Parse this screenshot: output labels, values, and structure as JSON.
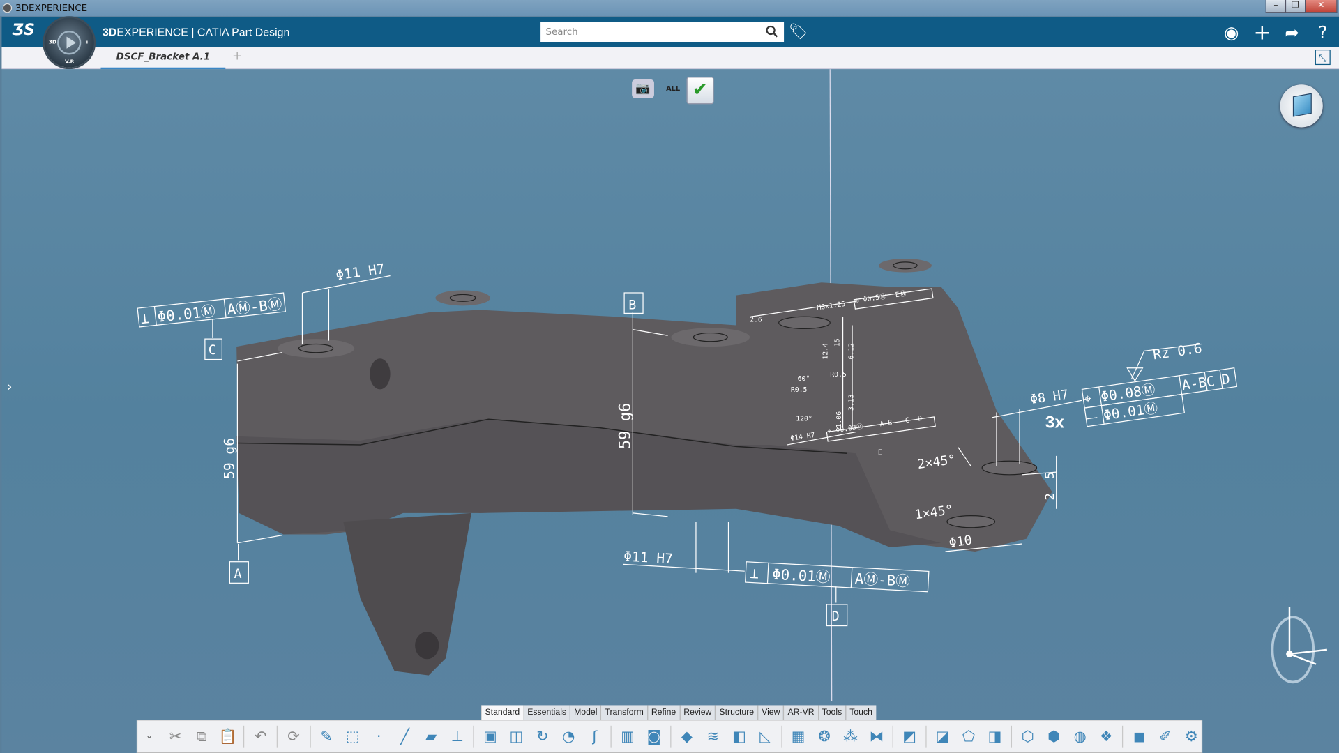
{
  "window": {
    "title": "3DEXPERIENCE",
    "controls": [
      "minimize",
      "restore",
      "close"
    ]
  },
  "header": {
    "brand_bold": "3D",
    "brand_rest": "EXPERIENCE",
    "brand_sep": " | ",
    "app": "CATIA Part Design",
    "search_placeholder": "Search",
    "compass_labels": [
      "3D",
      "V.R",
      "i"
    ]
  },
  "tabs": {
    "document": "DSCF_Bracket A.1",
    "add": "+"
  },
  "viewport": {
    "filter_label": "ALL"
  },
  "annotations": {
    "top_left_fcf": [
      "⊥",
      "Φ0.01Ⓜ",
      "AⓂ-BⓂ"
    ],
    "hole_top": "Φ11 H7",
    "datum_c": "C",
    "datum_b": "B",
    "datum_a": "A",
    "datum_d": "D",
    "datum_e": "E",
    "height_left": "59 g6",
    "height_mid": "59 g6",
    "hole_bottom": "Φ11 H7",
    "bottom_fcf": [
      "⊥",
      "Φ0.01Ⓜ",
      "AⓂ-BⓂ"
    ],
    "thread": "M8x1.25",
    "thread_fcf": [
      "◎",
      "Φ0.5Ⓜ",
      "EⓂ"
    ],
    "dim_2_6": "2.6",
    "dim_12_4": "12.4",
    "dim_15": "15",
    "dim_6_12": "6.12",
    "r05a": "R0.5",
    "r05b": "R0.5",
    "ang60": "60°",
    "ang120": "120°",
    "dim_1_06": "1.06",
    "dim_3_13": "3.13",
    "hole14": "Φ14 H7",
    "hole14_fcf": [
      "⌖",
      "Φ0.03Ⓜ",
      "A-B",
      "C",
      "D"
    ],
    "rz": "Rz 0.6",
    "hole8": "Φ8 H7",
    "count": "3x",
    "pos_fcf": [
      "⌖",
      "Φ0.08Ⓜ",
      "A-B",
      "C",
      "D"
    ],
    "flat_fcf": [
      "⏤",
      "Φ0.01Ⓜ"
    ],
    "chamfer1": "2×45°",
    "chamfer2": "1×45°",
    "dim_5": "5",
    "dim_2": "2",
    "hole10": "Φ10"
  },
  "toolbar": {
    "tabs": [
      "Standard",
      "Essentials",
      "Model",
      "Transform",
      "Refine",
      "Review",
      "Structure",
      "View",
      "AR-VR",
      "Tools",
      "Touch"
    ],
    "active_tab": "Standard",
    "tools": [
      {
        "name": "cut-icon",
        "g": "✂"
      },
      {
        "name": "copy-icon",
        "g": "⧉"
      },
      {
        "name": "paste-icon",
        "g": "📋"
      },
      {
        "name": "sep"
      },
      {
        "name": "undo-icon",
        "g": "↶"
      },
      {
        "name": "sep"
      },
      {
        "name": "update-icon",
        "g": "⟳"
      },
      {
        "name": "sep"
      },
      {
        "name": "sketch-icon",
        "g": "✎"
      },
      {
        "name": "positioned-sketch-icon",
        "g": "⬚"
      },
      {
        "name": "point-icon",
        "g": "·"
      },
      {
        "name": "line-icon",
        "g": "╱"
      },
      {
        "name": "plane-icon",
        "g": "▰"
      },
      {
        "name": "axis-system-icon",
        "g": "⊥"
      },
      {
        "name": "sep"
      },
      {
        "name": "pad-icon",
        "g": "▣"
      },
      {
        "name": "pocket-icon",
        "g": "◫"
      },
      {
        "name": "shaft-icon",
        "g": "↻"
      },
      {
        "name": "groove-icon",
        "g": "◔"
      },
      {
        "name": "rib-icon",
        "g": "ʃ"
      },
      {
        "name": "sep"
      },
      {
        "name": "thread-icon",
        "g": "▥"
      },
      {
        "name": "hole-icon",
        "g": "◙"
      },
      {
        "name": "sep"
      },
      {
        "name": "thick-surface-icon",
        "g": "◆"
      },
      {
        "name": "close-surface-icon",
        "g": "≋"
      },
      {
        "name": "shell-icon",
        "g": "◧"
      },
      {
        "name": "stiffener-icon",
        "g": "◺"
      },
      {
        "name": "sep"
      },
      {
        "name": "rectangular-pattern-icon",
        "g": "▦"
      },
      {
        "name": "circular-pattern-icon",
        "g": "❂"
      },
      {
        "name": "user-pattern-icon",
        "g": "⁂"
      },
      {
        "name": "mirror-icon",
        "g": "⧓"
      },
      {
        "name": "sep"
      },
      {
        "name": "draft-icon",
        "g": "◩"
      },
      {
        "name": "sep"
      },
      {
        "name": "fillet-icon",
        "g": "◪"
      },
      {
        "name": "chamfer-icon",
        "g": "⬠"
      },
      {
        "name": "remove-face-icon",
        "g": "◨"
      },
      {
        "name": "sep"
      },
      {
        "name": "add-body-icon",
        "g": "⬡"
      },
      {
        "name": "remove-body-icon",
        "g": "⬢"
      },
      {
        "name": "intersect-body-icon",
        "g": "◍"
      },
      {
        "name": "union-trim-icon",
        "g": "❖"
      },
      {
        "name": "sep"
      },
      {
        "name": "measure-icon",
        "g": "◼"
      },
      {
        "name": "3d-annotation-icon",
        "g": "✐"
      },
      {
        "name": "knowledge-icon",
        "g": "⚙"
      }
    ]
  },
  "colors": {
    "header": "#0f5b86",
    "viewport": "#5a86a3",
    "part": "#5e5b5e",
    "annotation": "#ffffff"
  }
}
